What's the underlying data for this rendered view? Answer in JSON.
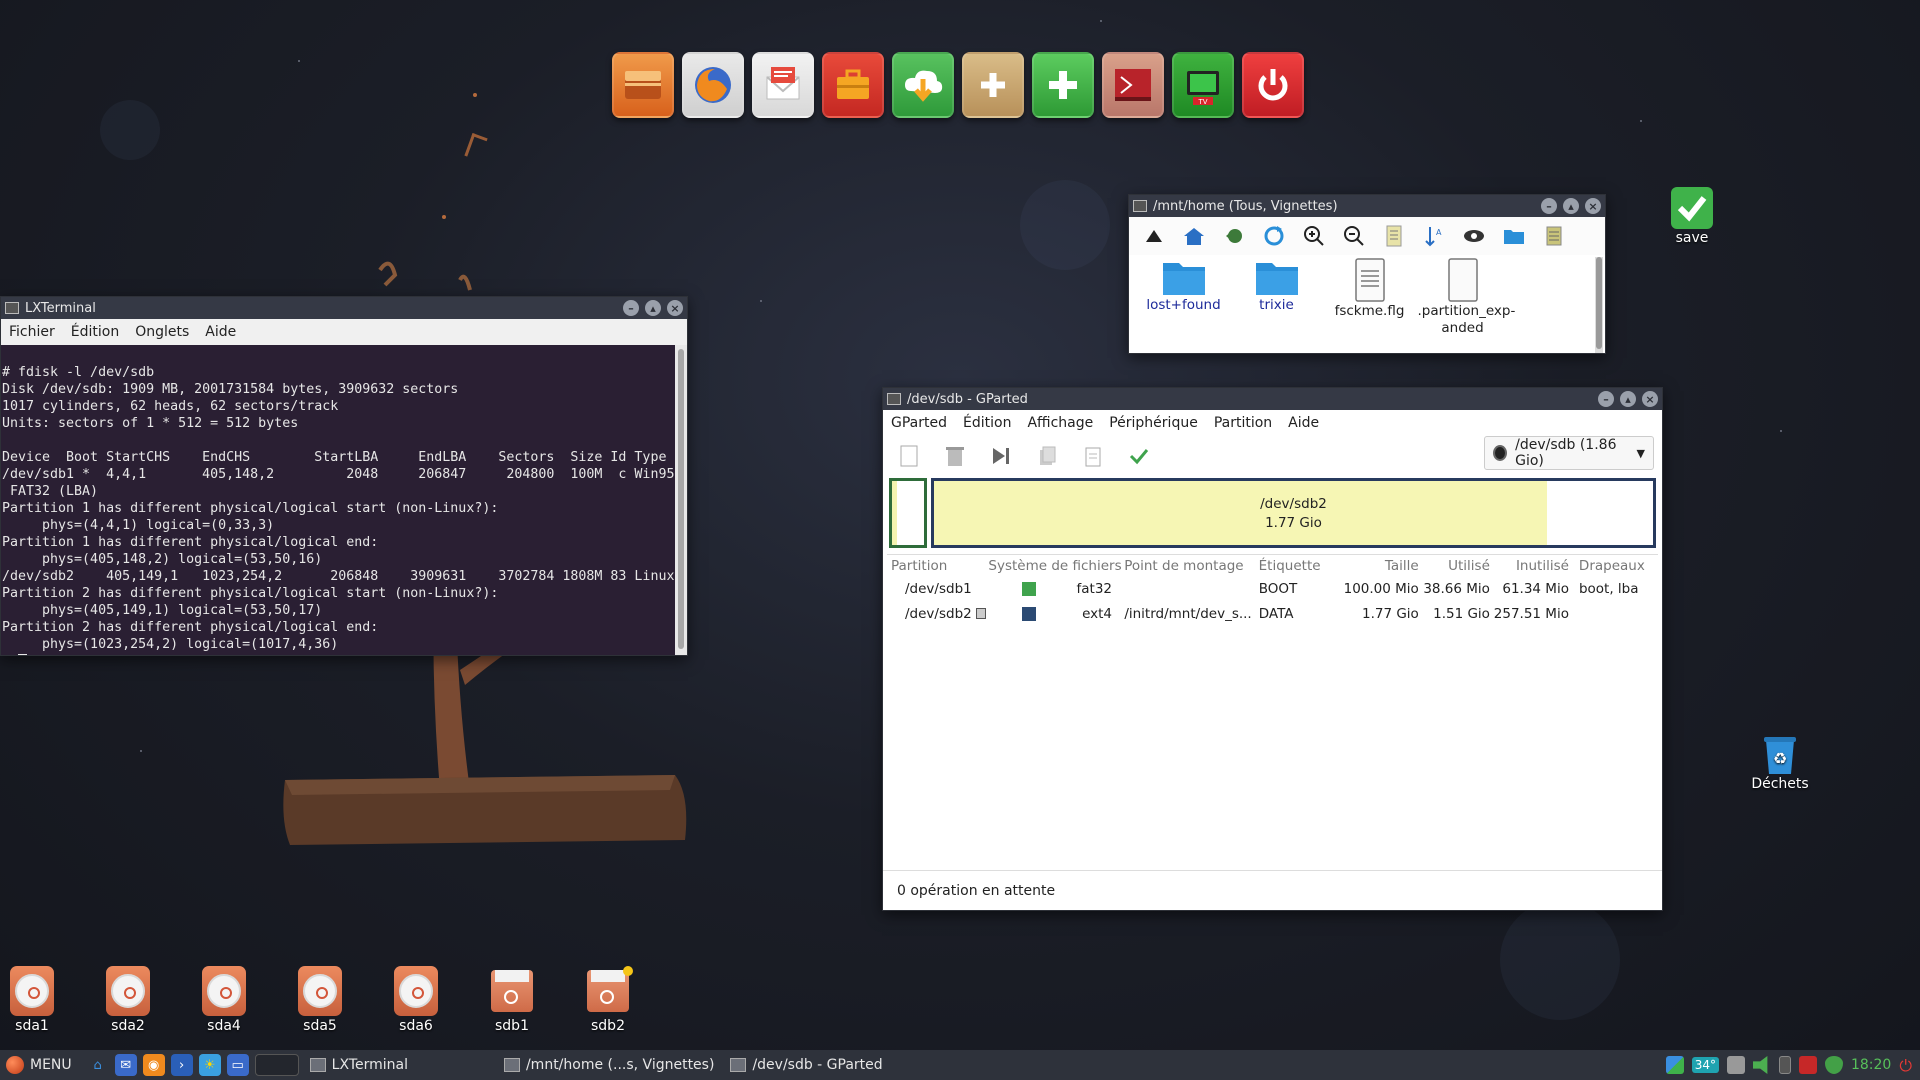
{
  "dock": {
    "items": [
      {
        "name": "wallet-icon",
        "bg": "#e9772e"
      },
      {
        "name": "firefox-icon",
        "bg": "#3a67c9"
      },
      {
        "name": "mail-icon",
        "bg": "#e5e5e5"
      },
      {
        "name": "briefcase-icon",
        "bg": "#d9332b"
      },
      {
        "name": "download-icon",
        "bg": "#3fae4a"
      },
      {
        "name": "folder-add-icon",
        "bg": "#c9a56e"
      },
      {
        "name": "add-icon",
        "bg": "#3fae4a"
      },
      {
        "name": "terminal-icon",
        "bg": "#cf8e78"
      },
      {
        "name": "tv-icon",
        "bg": "#2e9a31",
        "label": "TV"
      },
      {
        "name": "power-icon",
        "bg": "#d9252b"
      }
    ]
  },
  "terminal": {
    "title": "LXTerminal",
    "menu": [
      "Fichier",
      "Édition",
      "Onglets",
      "Aide"
    ],
    "lines": [
      "# fdisk -l /dev/sdb",
      "Disk /dev/sdb: 1909 MB, 2001731584 bytes, 3909632 sectors",
      "1017 cylinders, 62 heads, 62 sectors/track",
      "Units: sectors of 1 * 512 = 512 bytes",
      "",
      "Device  Boot StartCHS    EndCHS        StartLBA     EndLBA    Sectors  Size Id Type",
      "/dev/sdb1 *  4,4,1       405,148,2         2048     206847     204800  100M  c Win95",
      " FAT32 (LBA)",
      "Partition 1 has different physical/logical start (non-Linux?):",
      "     phys=(4,4,1) logical=(0,33,3)",
      "Partition 1 has different physical/logical end:",
      "     phys=(405,148,2) logical=(53,50,16)",
      "/dev/sdb2    405,149,1   1023,254,2      206848    3909631    3702784 1808M 83 Linux",
      "Partition 2 has different physical/logical start (non-Linux?):",
      "     phys=(405,149,1) logical=(53,50,17)",
      "Partition 2 has different physical/logical end:",
      "     phys=(1023,254,2) logical=(1017,4,36)"
    ],
    "prompt": "# "
  },
  "filemanager": {
    "title": "/mnt/home (Tous, Vignettes)",
    "toolbar": [
      "up-icon",
      "home-icon",
      "back-icon",
      "refresh-icon",
      "zoom-in-icon",
      "zoom-out-icon",
      "notes-icon",
      "sort-icon",
      "eye-icon",
      "folder-icon",
      "list-icon"
    ],
    "files": [
      {
        "label": "lost+found",
        "type": "folder"
      },
      {
        "label": "trixie",
        "type": "folder"
      },
      {
        "label": "fsckme.flg",
        "type": "text"
      },
      {
        "label": ".partition_exp-anded",
        "type": "blank"
      }
    ]
  },
  "gparted": {
    "title": "/dev/sdb - GParted",
    "menu": [
      "GParted",
      "Édition",
      "Affichage",
      "Périphérique",
      "Partition",
      "Aide"
    ],
    "device": "/dev/sdb (1.86 Gio)",
    "map": {
      "name": "/dev/sdb2",
      "size": "1.77 Gio",
      "used_fraction": 0.853
    },
    "columns": [
      "Partition",
      "Système de fichiers",
      "Point de montage",
      "Étiquette",
      "Taille",
      "Utilisé",
      "Inutilisé",
      "Drapeaux"
    ],
    "rows": [
      {
        "partition": "/dev/sdb1",
        "fs": "fat32",
        "fs_color": "#3fa34d",
        "mount": "",
        "label": "BOOT",
        "size": "100.00 Mio",
        "used": "38.66 Mio",
        "unused": "61.34 Mio",
        "flags": "boot, lba"
      },
      {
        "partition": "/dev/sdb2",
        "fs": "ext4",
        "fs_color": "#2b4a73",
        "mount": "/initrd/mnt/dev_s...",
        "label": "DATA",
        "size": "1.77 Gio",
        "used": "1.51 Gio",
        "unused": "257.51 Mio",
        "flags": ""
      }
    ],
    "status": "0 opération en attente"
  },
  "desktop": {
    "save_label": "save",
    "trash_label": "Déchets",
    "drives": [
      "sda1",
      "sda2",
      "sda4",
      "sda5",
      "sda6"
    ],
    "usb": [
      "sdb1",
      "sdb2"
    ]
  },
  "taskbar": {
    "menu_label": "MENU",
    "tasks": [
      "LXTerminal",
      "/mnt/home (...s, Vignettes)",
      "/dev/sdb - GParted"
    ],
    "temp": "34°",
    "clock": "18:20"
  }
}
